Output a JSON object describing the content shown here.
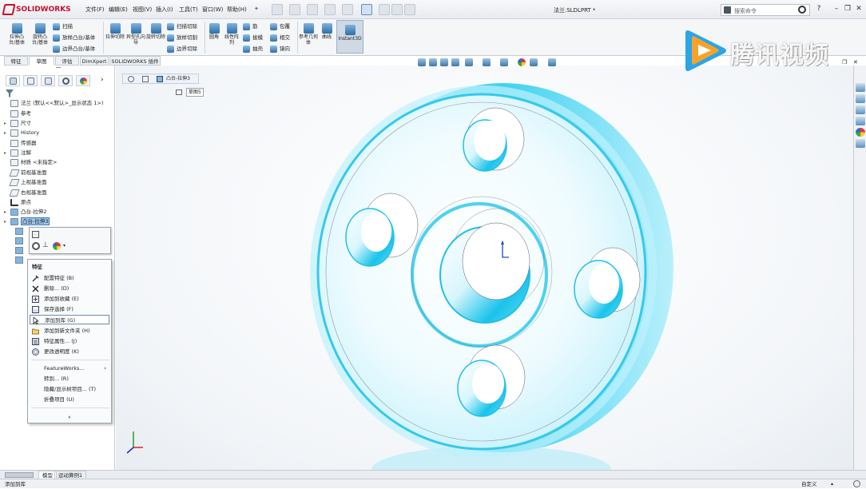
{
  "app": {
    "name": "SOLIDWORKS",
    "doc_title": "法兰.SLDLPRT *"
  },
  "menu": [
    "文件(F)",
    "编辑(E)",
    "视图(V)",
    "插入(I)",
    "工具(T)",
    "窗口(W)",
    "帮助(H)"
  ],
  "search": {
    "placeholder": "搜索命令"
  },
  "command_manager": {
    "big": [
      "拉伸凸台/基体",
      "旋转凸台/基体",
      "拉伸切除",
      "异型孔向导",
      "旋转切除",
      "圆角",
      "线性阵列",
      "参考几何体",
      "曲线",
      "Instant3D"
    ],
    "small": [
      "扫描",
      "放样凸台/基体",
      "边界凸台/基体",
      "扫描切除",
      "放样切割",
      "边界切除",
      "筋",
      "拔模",
      "抽壳",
      "包覆",
      "相交",
      "镜向"
    ]
  },
  "tabs": [
    "特征",
    "草图",
    "评估",
    "DimXpert",
    "SOLIDWORKS 插件"
  ],
  "breadcrumb": {
    "label": "凸台-拉伸3",
    "sketch": "草图5"
  },
  "tree": [
    {
      "label": "法兰 (默认<<默认>_显示状态 1>)",
      "arrow": ""
    },
    {
      "label": "参考",
      "arrow": ""
    },
    {
      "label": "尺寸",
      "arrow": "▸"
    },
    {
      "label": "History",
      "arrow": "▸"
    },
    {
      "label": "传感器",
      "arrow": ""
    },
    {
      "label": "注解",
      "arrow": "▸"
    },
    {
      "label": "材质 <未指定>",
      "arrow": ""
    },
    {
      "label": "前视基准面",
      "arrow": ""
    },
    {
      "label": "上视基准面",
      "arrow": ""
    },
    {
      "label": "右视基准面",
      "arrow": ""
    },
    {
      "label": "原点",
      "arrow": ""
    },
    {
      "label": "凸台-拉伸2",
      "arrow": "▸"
    },
    {
      "label": "凸台-拉伸3",
      "arrow": "▸"
    }
  ],
  "context_menu": {
    "header": "特征",
    "items": [
      "配置特征 (B)",
      "删除... (D)",
      "添加到收藏 (E)",
      "保存选择 (F)",
      "添加到库 (G)",
      "添加到新文件夹 (H)",
      "特征属性... (J)",
      "更改透明度 (K)",
      "FeatureWorks...",
      "转到... (R)",
      "隐藏/显示树项目... (T)",
      "折叠项目 (U)",
      "»"
    ]
  },
  "bottom_tabs": [
    "模型",
    "运动算例1"
  ],
  "status": {
    "left": "添加到库",
    "right": "自定义"
  },
  "watermark": {
    "text": "腾讯视频"
  },
  "colors": {
    "part": "#26c8ec",
    "part_light": "#bff1fc",
    "selection": "#9dc6ee",
    "logo": "#c8102e"
  }
}
